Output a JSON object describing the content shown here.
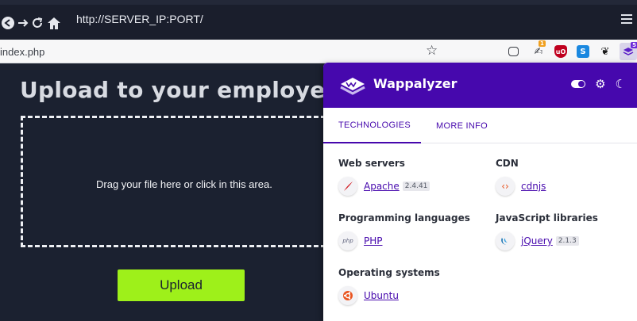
{
  "browser": {
    "url": "http://SERVER_IP:PORT/",
    "address_text": "index.php",
    "nav": {
      "back": "back-icon",
      "forward": "forward-icon",
      "reload": "reload-icon",
      "home": "home-icon"
    },
    "extension_badges": {
      "notes": "1",
      "wappalyzer": "5"
    }
  },
  "page": {
    "heading": "Upload to your employee a",
    "dropzone_text": "Drag your file here or click in this area.",
    "upload_label": "Upload",
    "colors": {
      "background": "#1b2130",
      "button": "#9ef01a",
      "text": "#d8dbe2"
    }
  },
  "wappalyzer": {
    "brand": "Wappalyzer",
    "accent": "#4608ad",
    "tabs": [
      {
        "label": "TECHNOLOGIES",
        "active": true
      },
      {
        "label": "MORE INFO",
        "active": false
      }
    ],
    "categories": [
      {
        "name": "Web servers",
        "techs": [
          {
            "name": "Apache",
            "version": "2.4.41",
            "icon": "apache-feather-icon"
          }
        ]
      },
      {
        "name": "CDN",
        "techs": [
          {
            "name": "cdnjs",
            "version": "",
            "icon": "cdnjs-brackets-icon"
          }
        ]
      },
      {
        "name": "Programming languages",
        "techs": [
          {
            "name": "PHP",
            "version": "",
            "icon": "php-icon"
          }
        ]
      },
      {
        "name": "JavaScript libraries",
        "techs": [
          {
            "name": "jQuery",
            "version": "2.1.3",
            "icon": "jquery-icon"
          }
        ]
      },
      {
        "name": "Operating systems",
        "techs": [
          {
            "name": "Ubuntu",
            "version": "",
            "icon": "ubuntu-icon"
          }
        ]
      }
    ]
  }
}
